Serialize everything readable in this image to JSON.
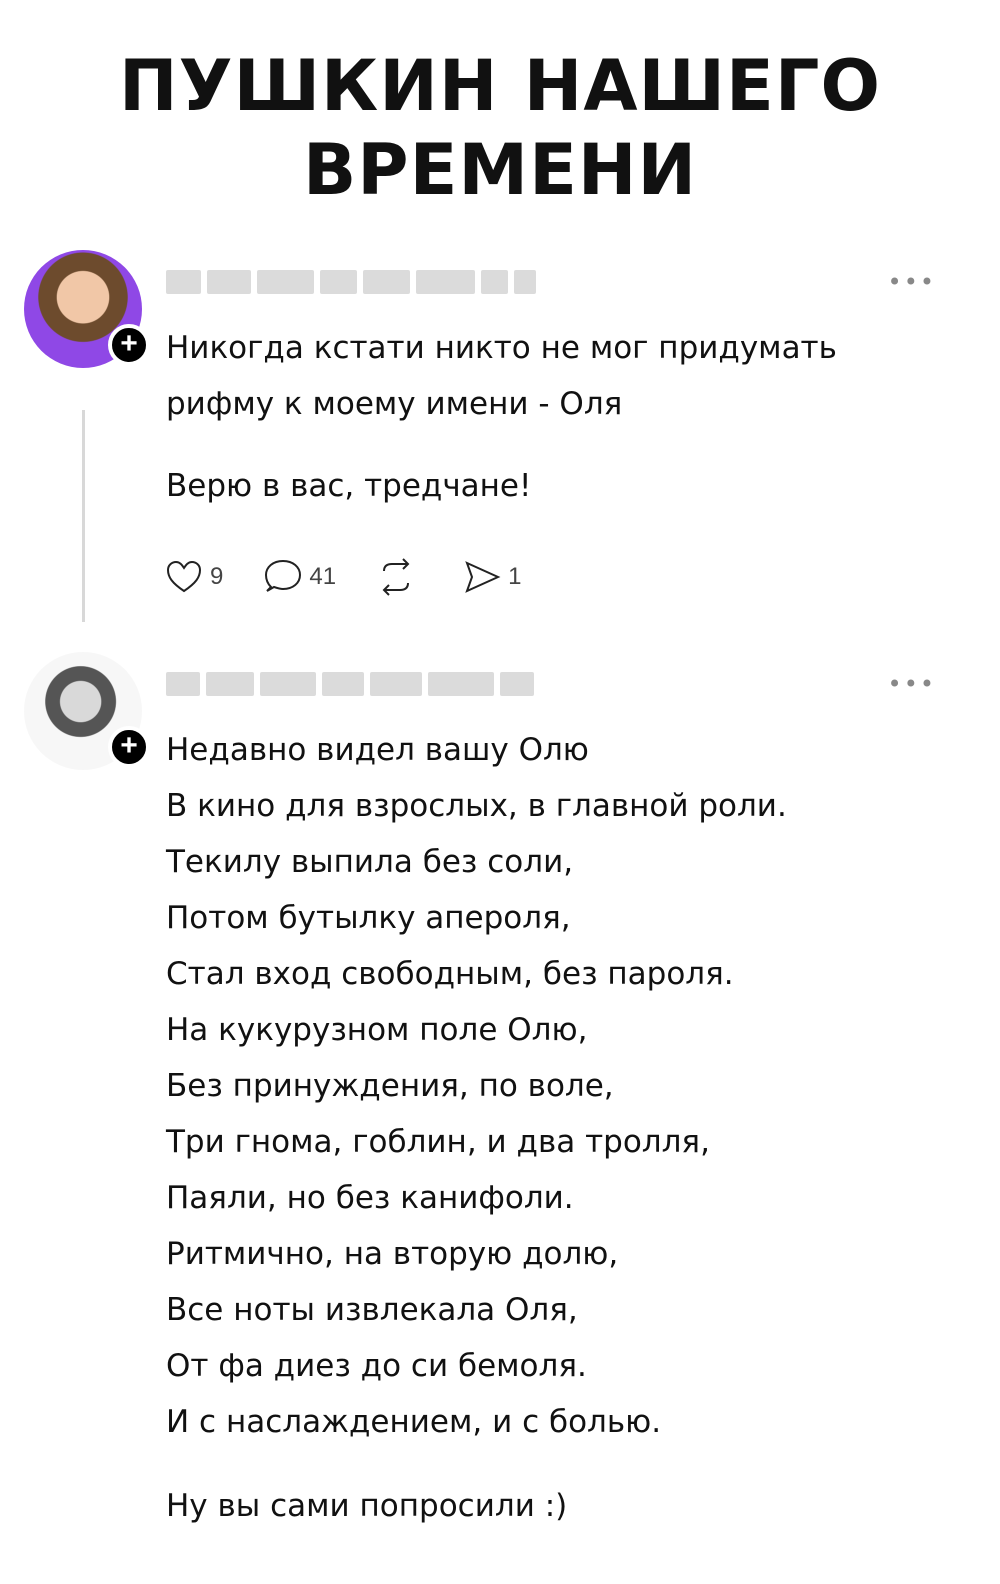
{
  "headline": [
    "ПУШКИН НАШЕГО",
    "ВРЕМЕНИ"
  ],
  "posts": [
    {
      "text_paragraphs": [
        "Никогда кстати никто не мог придумать",
        "рифму к моему имени - Оля",
        "Верю в вас, тредчане!"
      ],
      "actions": {
        "likes": "9",
        "replies": "41",
        "reposts": "",
        "shares": "1"
      }
    },
    {
      "poem_lines": [
        "Недавно видел вашу Олю",
        "В кино для взрослых, в главной роли.",
        "Текилу выпила без соли,",
        "Потом бутылку апероля,",
        "Стал вход свободным, без пароля.",
        "На кукурузном поле Олю,",
        "Без принуждения, по воле,",
        "Три гнома, гоблин, и два тролля,",
        "Паяли, но без канифоли.",
        "Ритмично, на вторую долю,",
        "Все ноты извлекала Оля,",
        "От фа диез до си бемоля.",
        "И с наслаждением, и с болью."
      ],
      "closing": "Ну вы сами попросили :)"
    }
  ],
  "icons": {
    "like": "heart-icon",
    "reply": "comment-icon",
    "repost": "repost-icon",
    "share": "send-icon",
    "more": "more-icon",
    "follow": "plus-icon"
  }
}
